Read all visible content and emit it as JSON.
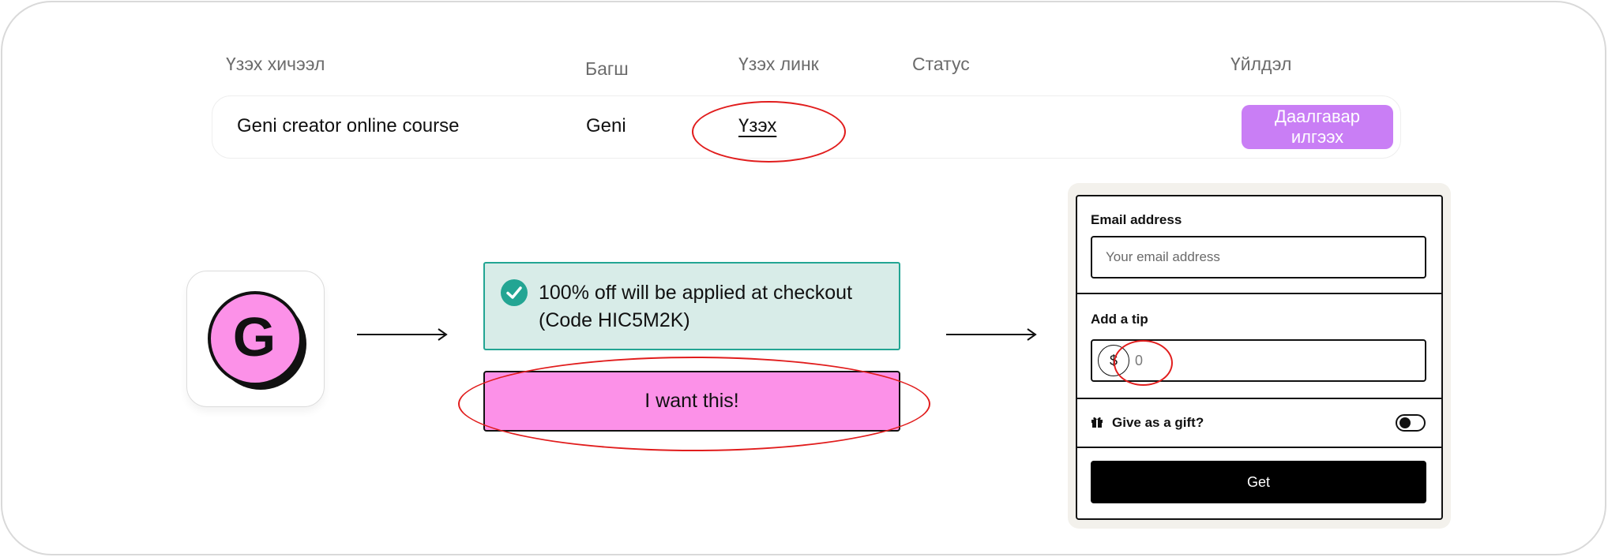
{
  "table": {
    "headers": {
      "lesson": "Үзэх хичээл",
      "teacher": "Багш",
      "link": "Үзэх линк",
      "status": "Статус",
      "action": "Үйлдэл"
    },
    "row": {
      "course": "Geni creator online course",
      "teacher": "Geni",
      "link_label": "Үзэх",
      "status": "",
      "action_label": "Даалгавар илгээх"
    }
  },
  "logo": {
    "letter": "G",
    "icon": "geni-logo-icon",
    "bg_color": "#fc91e8"
  },
  "discount": {
    "message": "100% off will be applied at checkout (Code HIC5M2K)",
    "icon": "check-circle-icon",
    "accent": "#23a593"
  },
  "cta": {
    "label": "I want this!",
    "color": "#fc91e8"
  },
  "checkout": {
    "email_label": "Email address",
    "email_placeholder": "Your email address",
    "tip_label": "Add a tip",
    "tip_currency": "$",
    "tip_placeholder": "0",
    "gift_label": "Give as a gift?",
    "gift_icon": "gift-icon",
    "get_label": "Get"
  },
  "colors": {
    "annotation": "#e11d1d",
    "action_button": "#c97ef5"
  }
}
